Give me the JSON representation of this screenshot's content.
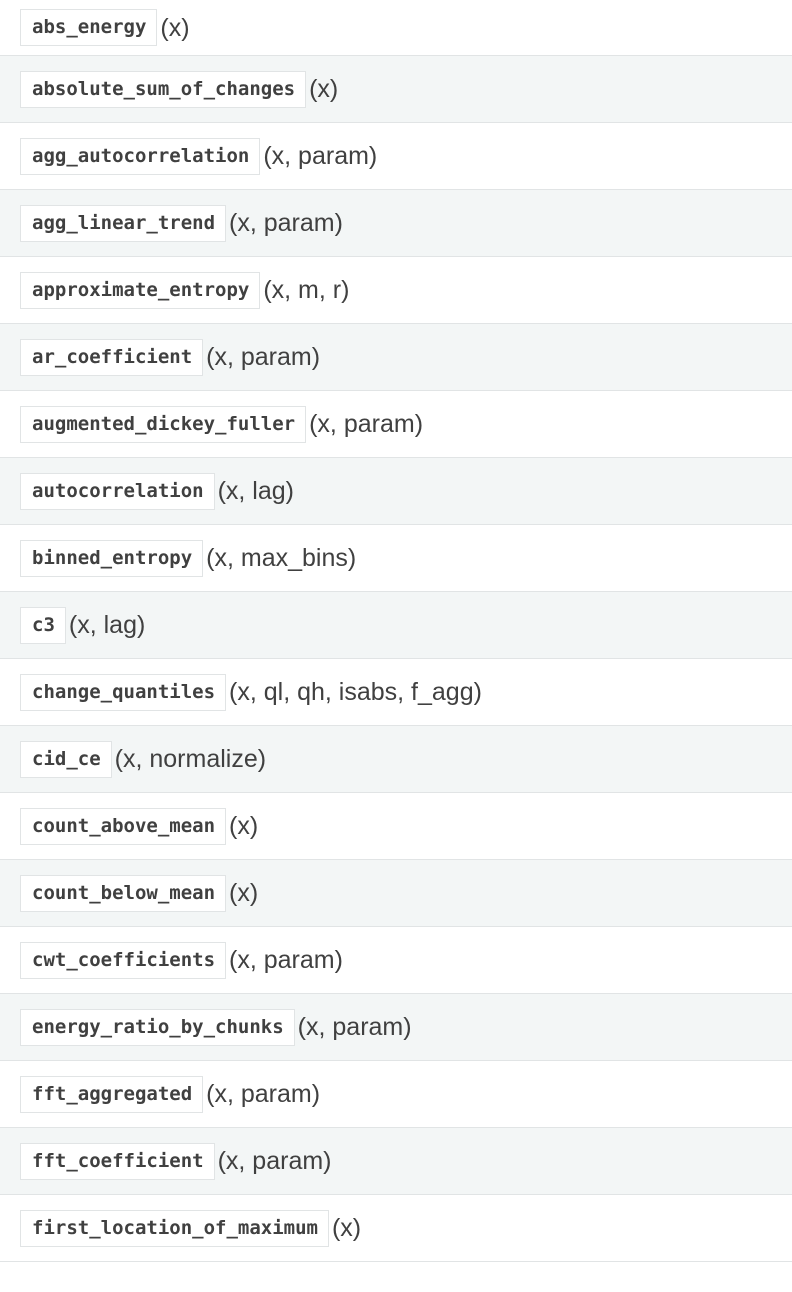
{
  "functions": [
    {
      "name": "abs_energy",
      "signature": "(x)"
    },
    {
      "name": "absolute_sum_of_changes",
      "signature": "(x)"
    },
    {
      "name": "agg_autocorrelation",
      "signature": "(x, param)"
    },
    {
      "name": "agg_linear_trend",
      "signature": "(x, param)"
    },
    {
      "name": "approximate_entropy",
      "signature": "(x, m, r)"
    },
    {
      "name": "ar_coefficient",
      "signature": "(x, param)"
    },
    {
      "name": "augmented_dickey_fuller",
      "signature": "(x, param)"
    },
    {
      "name": "autocorrelation",
      "signature": "(x, lag)"
    },
    {
      "name": "binned_entropy",
      "signature": "(x, max_bins)"
    },
    {
      "name": "c3",
      "signature": "(x, lag)"
    },
    {
      "name": "change_quantiles",
      "signature": "(x, ql, qh, isabs, f_agg)"
    },
    {
      "name": "cid_ce",
      "signature": "(x, normalize)"
    },
    {
      "name": "count_above_mean",
      "signature": "(x)"
    },
    {
      "name": "count_below_mean",
      "signature": "(x)"
    },
    {
      "name": "cwt_coefficients",
      "signature": "(x, param)"
    },
    {
      "name": "energy_ratio_by_chunks",
      "signature": "(x, param)"
    },
    {
      "name": "fft_aggregated",
      "signature": "(x, param)"
    },
    {
      "name": "fft_coefficient",
      "signature": "(x, param)"
    },
    {
      "name": "first_location_of_maximum",
      "signature": "(x)"
    }
  ]
}
